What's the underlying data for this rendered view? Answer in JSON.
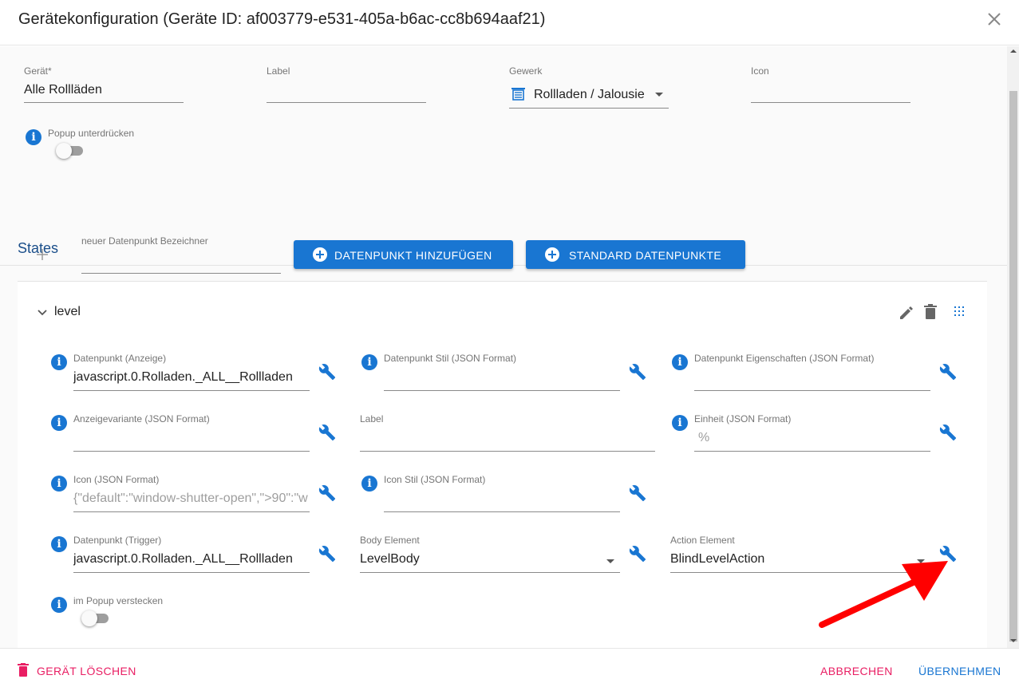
{
  "dialog": {
    "title": "Gerätekonfiguration (Geräte ID: af003779-e531-405a-b6ac-cc8b694aaf21)",
    "close_icon": "close-icon"
  },
  "general": {
    "device": {
      "label": "Gerät",
      "required_mark": "*",
      "value": "Alle Rollläden"
    },
    "label": {
      "label": "Label",
      "value": ""
    },
    "trade": {
      "label": "Gewerk",
      "value": "Rollladen / Jalousie",
      "icon": "blinds-icon"
    },
    "icon": {
      "label": "Icon",
      "value": ""
    },
    "suppress_popup": {
      "label": "Popup unterdrücken",
      "checked": false
    }
  },
  "states": {
    "title": "States",
    "new_datapoint": {
      "label": "neuer Datenpunkt Bezeichner",
      "value": ""
    },
    "add_button": "DATENPUNKT HINZUFÜGEN",
    "standard_button": "STANDARD DATENPUNKTE"
  },
  "state_card": {
    "name": "level",
    "expanded": true,
    "fields": {
      "dp_display": {
        "label": "Datenpunkt (Anzeige)",
        "value": "javascript.0.Rolladen._ALL__Rollladen"
      },
      "dp_style": {
        "label": "Datenpunkt Stil (JSON Format)",
        "value": ""
      },
      "dp_props": {
        "label": "Datenpunkt Eigenschaften (JSON Format)",
        "value": ""
      },
      "display_variant": {
        "label": "Anzeigevariante (JSON Format)",
        "value": ""
      },
      "label": {
        "label": "Label",
        "value": ""
      },
      "unit": {
        "label": "Einheit (JSON Format)",
        "placeholder": "%"
      },
      "icon": {
        "label": "Icon (JSON Format)",
        "placeholder": "{\"default\":\"window-shutter-open\",\">90\":\"w"
      },
      "icon_style": {
        "label": "Icon Stil (JSON Format)",
        "value": ""
      },
      "dp_trigger": {
        "label": "Datenpunkt (Trigger)",
        "value": "javascript.0.Rolladen._ALL__Rollladen"
      },
      "body_element": {
        "label": "Body Element",
        "value": "LevelBody"
      },
      "action_element": {
        "label": "Action Element",
        "value": "BlindLevelAction"
      },
      "hide_in_popup": {
        "label": "im Popup verstecken",
        "checked": false
      }
    }
  },
  "footer": {
    "delete": "GERÄT LÖSCHEN",
    "cancel": "ABBRECHEN",
    "apply": "ÜBERNEHMEN"
  },
  "colors": {
    "primary": "#1976d2",
    "danger": "#e91e63",
    "annotation_arrow": "#ff0000"
  }
}
